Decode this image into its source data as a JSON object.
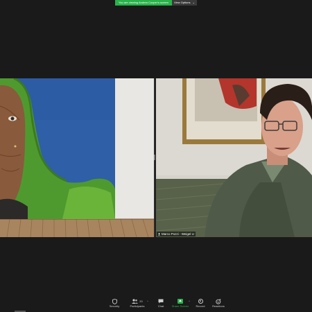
{
  "banner": {
    "viewing_text": "You are viewing Andrea Cooper's screen",
    "view_options_label": "View Options",
    "chevron": "⌄"
  },
  "video": {
    "participant_name": "Marco Pozzi - Weigel U"
  },
  "toolbar": {
    "security_label": "Security",
    "participants_label": "Participants",
    "participants_count": "20",
    "chat_label": "Chat",
    "share_screen_label": "Share Screen",
    "record_label": "Record",
    "reactions_label": "Reactions",
    "caret": "^"
  },
  "colors": {
    "share_green": "#2bb24c",
    "background": "#1a1a1a"
  },
  "icons": [
    "shield-icon",
    "participants-icon",
    "chat-icon",
    "share-screen-icon",
    "record-icon",
    "reactions-icon",
    "microphone-icon"
  ]
}
